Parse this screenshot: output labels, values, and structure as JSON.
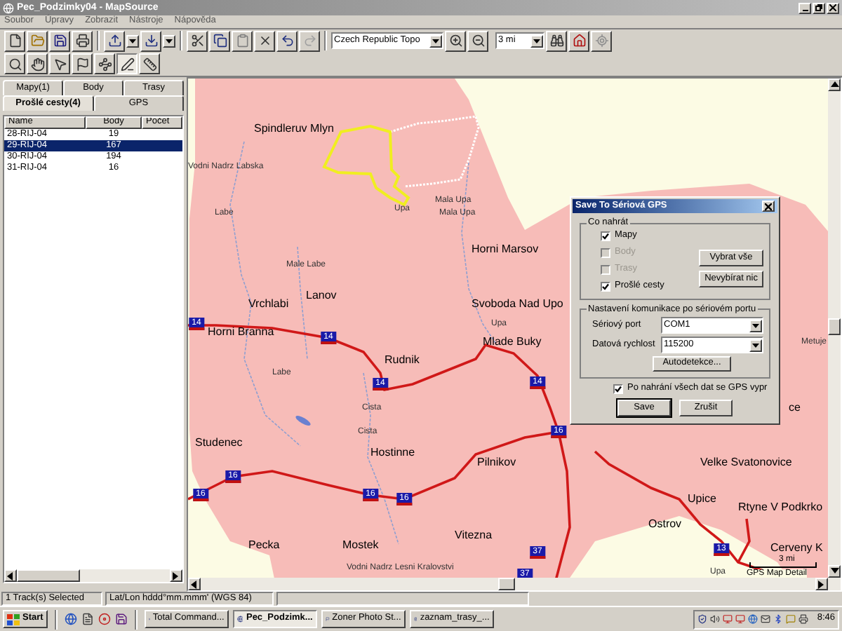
{
  "window": {
    "title": "Pec_Podzimky04 - MapSource"
  },
  "menu": [
    "Soubor",
    "Úpravy",
    "Zobrazit",
    "Nástroje",
    "Nápověda"
  ],
  "toolbar": {
    "map_product": "Czech Republic Topo",
    "zoom_scale": "3 mi"
  },
  "tools": [
    {
      "kind": "zoom",
      "selected": false
    },
    {
      "kind": "pan",
      "selected": false
    },
    {
      "kind": "select",
      "selected": false
    },
    {
      "kind": "waypoint",
      "selected": false
    },
    {
      "kind": "route",
      "selected": false
    },
    {
      "kind": "track",
      "selected": true
    },
    {
      "kind": "measure",
      "selected": false
    }
  ],
  "sidebar": {
    "tab_rows": [
      [
        {
          "label": "Mapy(1)",
          "selected": false
        },
        {
          "label": "Body",
          "selected": false
        },
        {
          "label": "Trasy",
          "selected": false
        }
      ],
      [
        {
          "label": "Prošlé cesty(4)",
          "selected": true
        },
        {
          "label": "GPS",
          "selected": false
        }
      ]
    ],
    "columns": [
      "Name",
      "Body",
      "Počet"
    ],
    "rows": [
      {
        "name": "28-RIJ-04",
        "body": "19",
        "selected": false
      },
      {
        "name": "29-RIJ-04",
        "body": "167",
        "selected": true
      },
      {
        "name": "30-RIJ-04",
        "body": "194",
        "selected": false
      },
      {
        "name": "31-RIJ-04",
        "body": "16",
        "selected": false
      }
    ]
  },
  "map": {
    "labels": [
      {
        "text": "Spindleruv Mlyn",
        "kind": "town"
      },
      {
        "text": "Vodni Nadrz Labska",
        "kind": "water"
      },
      {
        "text": "Mala Upa",
        "kind": "water"
      },
      {
        "text": "Upa",
        "kind": "water"
      },
      {
        "text": "Labe",
        "kind": "water"
      },
      {
        "text": "Mala Upa",
        "kind": "water"
      },
      {
        "text": "Horni Marsov",
        "kind": "town"
      },
      {
        "text": "Male Labe",
        "kind": "water"
      },
      {
        "text": "Lanov",
        "kind": "town"
      },
      {
        "text": "Vrchlabi",
        "kind": "town"
      },
      {
        "text": "Svoboda Nad Upo",
        "kind": "town"
      },
      {
        "text": "Upa",
        "kind": "water"
      },
      {
        "text": "Horni Branna",
        "kind": "town"
      },
      {
        "text": "Metuje",
        "kind": "water"
      },
      {
        "text": "Mlade Buky",
        "kind": "town"
      },
      {
        "text": "Rudnik",
        "kind": "town"
      },
      {
        "text": "Labe",
        "kind": "water"
      },
      {
        "text": "Cista",
        "kind": "water"
      },
      {
        "text": "ce",
        "kind": "town"
      },
      {
        "text": "Cista",
        "kind": "water"
      },
      {
        "text": "Studenec",
        "kind": "town"
      },
      {
        "text": "Hostinne",
        "kind": "town"
      },
      {
        "text": "Pilnikov",
        "kind": "town"
      },
      {
        "text": "Velke Svatonovice",
        "kind": "town"
      },
      {
        "text": "Upice",
        "kind": "town"
      },
      {
        "text": "Rtyne V Podkrko",
        "kind": "town"
      },
      {
        "text": "Ostrov",
        "kind": "town"
      },
      {
        "text": "Vitezna",
        "kind": "town"
      },
      {
        "text": "Pecka",
        "kind": "town"
      },
      {
        "text": "Mostek",
        "kind": "town"
      },
      {
        "text": "Cerveny K",
        "kind": "town"
      },
      {
        "text": "Vodni Nadrz Lesni Kralovstvi",
        "kind": "water"
      },
      {
        "text": "Upa",
        "kind": "water"
      }
    ],
    "route_shields": [
      "14",
      "14",
      "14",
      "14",
      "16",
      "16",
      "16",
      "16",
      "16",
      "37",
      "13",
      "37"
    ],
    "scale": "3 mi",
    "detail_note": "GPS Map Detail"
  },
  "dialog": {
    "title": "Save To Sériová GPS",
    "content_group": {
      "legend": "Co nahrát",
      "items": [
        {
          "label": "Mapy",
          "checked": true,
          "disabled": false
        },
        {
          "label": "Body",
          "checked": false,
          "disabled": true
        },
        {
          "label": "Trasy",
          "checked": false,
          "disabled": true
        },
        {
          "label": "Prošlé cesty",
          "checked": true,
          "disabled": false
        }
      ],
      "buttons": [
        "Vybrat vše",
        "Nevybírat nic"
      ]
    },
    "port_group": {
      "legend": "Nastavení komunikace po sériovém portu",
      "fields": [
        {
          "label": "Sériový port",
          "value": "COM1"
        },
        {
          "label": "Datová rychlost",
          "value": "115200"
        }
      ],
      "button": "Autodetekce..."
    },
    "power_off": {
      "label": "Po nahrání všech dat se GPS vypr",
      "checked": true
    },
    "buttons": [
      {
        "label": "Save",
        "default": true
      },
      {
        "label": "Zrušit",
        "default": false
      }
    ]
  },
  "status_bar": [
    "1 Track(s) Selected",
    "Lat/Lon hddd°mm.mmm' (WGS 84)"
  ],
  "taskbar": {
    "start": "Start",
    "tasks": [
      {
        "label": "Total Command...",
        "selected": false
      },
      {
        "label": "Pec_Podzimk...",
        "selected": true
      },
      {
        "label": "Zoner Photo St...",
        "selected": false
      },
      {
        "label": "zaznam_trasy_...",
        "selected": false
      }
    ],
    "clock": "8:46"
  }
}
